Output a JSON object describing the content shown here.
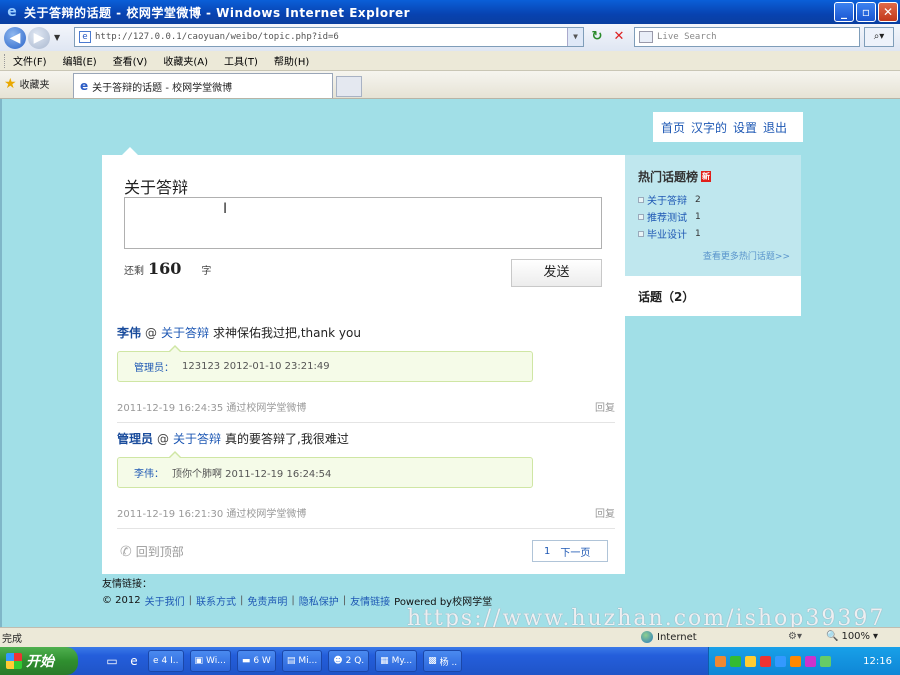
{
  "window": {
    "title": "关于答辩的话题 - 校网学堂微博 - Windows Internet Explorer"
  },
  "address": {
    "url": "http://127.0.0.1/caoyuan/weibo/topic.php?id=6"
  },
  "search": {
    "placeholder": "Live Search"
  },
  "menu": {
    "items": [
      "文件(F)",
      "编辑(E)",
      "查看(V)",
      "收藏夹(A)",
      "工具(T)",
      "帮助(H)"
    ]
  },
  "favorites": {
    "label": "收藏夹"
  },
  "tab": {
    "label": "关于答辩的话题 - 校网学堂微博"
  },
  "topnav": {
    "items": [
      "首页",
      "汉字的",
      "设置",
      "退出"
    ]
  },
  "compose": {
    "title": "关于答辩",
    "remaining_prefix": "还剩",
    "remaining_count": "160",
    "remaining_suffix": "字",
    "send_label": "发送"
  },
  "posts": [
    {
      "author": "李伟",
      "at": "@",
      "topic": "关于答辩",
      "text": "求神保佑我过把,thank you",
      "reply_author": "管理员：",
      "reply_text": "123123 2012-01-10 23:21:49",
      "meta": "2011-12-19 16:24:35 通过校网学堂微博",
      "reply_label": "回复"
    },
    {
      "author": "管理员",
      "at": "@",
      "topic": "关于答辩",
      "text": "真的要答辩了,我很难过",
      "reply_author": "李伟：",
      "reply_text": "顶你个肺啊 2011-12-19 16:24:54",
      "meta": "2011-12-19 16:21:30 通过校网学堂微博",
      "reply_label": "回复"
    }
  ],
  "back_home": "回到顶部",
  "pager": {
    "page": "1",
    "next": "下一页"
  },
  "sidebar": {
    "heading": "热门话题榜",
    "new_badge": "新",
    "hot_topics": [
      {
        "name": "关于答辩",
        "count": "2"
      },
      {
        "name": "推荐测试",
        "count": "1"
      },
      {
        "name": "毕业设计",
        "count": "1"
      }
    ],
    "more": "查看更多热门话题>>",
    "topics_label": "话题（2）"
  },
  "footer": {
    "friend_links": "友情链接：",
    "copyright": "© 2012",
    "links": [
      "关于我们",
      "联系方式",
      "免责声明",
      "隐私保护",
      "友情链接"
    ],
    "powered": "Powered by校网学堂"
  },
  "watermark": "https://www.huzhan.com/ishop39397",
  "statusbar": {
    "status": "完成",
    "zone": "Internet",
    "zoom": "100%"
  },
  "taskbar": {
    "start": "开始",
    "buttons": [
      "4 I..",
      "Wi...",
      "6 W",
      "Mi...",
      "2 Q.",
      "My...",
      "杨 .."
    ],
    "time": "12:16"
  }
}
